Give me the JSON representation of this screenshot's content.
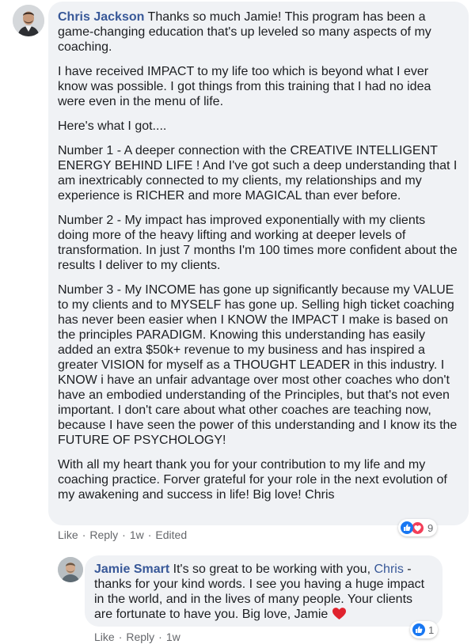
{
  "comment": {
    "author": "Chris Jackson",
    "first_line": "Thanks so much Jamie! This program has been a game-changing education that's up leveled so many aspects of my coaching.",
    "paragraphs": [
      "I have received IMPACT to my life too which is beyond what I ever know was possible. I got things from this training that I had no idea were even in the menu of life.",
      "Here's what I got....",
      "Number 1 - A deeper connection with the CREATIVE INTELLIGENT ENERGY BEHIND LIFE ! And I've got such a deep understanding that I am inextricably connected to my clients, my relationships and my experience is RICHER and more MAGICAL than ever before.",
      "Number 2 - My impact has improved exponentially with my clients doing more of the heavy lifting and working at deeper levels of transformation. In just 7 months I'm 100 times more confident about the results I deliver to my clients.",
      "Number 3 - My INCOME has gone up significantly because my VALUE to my clients and to MYSELF has gone up. Selling high ticket coaching has never been easier when I KNOW the IMPACT I make is based on the principles PARADIGM. Knowing this understanding has easily added an extra $50k+ revenue to my business and has inspired a greater VISION for myself as a THOUGHT LEADER in this industry. I KNOW i have an unfair advantage over most other coaches who don't have an embodied understanding of the Principles, but that's not even important. I don't care about what other coaches are teaching now, because I have seen the power of this understanding and I know its the FUTURE OF PSYCHOLOGY!",
      "With all my heart thank you for your contribution to my life and my coaching practice. Forver grateful for your role in the next evolution of my awakening and success in life! Big love! Chris"
    ],
    "actions": {
      "like": "Like",
      "reply": "Reply",
      "time": "1w",
      "edited": "Edited",
      "sep": "·"
    },
    "reaction_count": "9"
  },
  "reply": {
    "author": "Jamie Smart",
    "text_before_mention": "It's so great to be working with you,",
    "mention": "Chris",
    "text_after_mention": "- thanks for your kind words. I see you having a huge impact in the world, and in the lives of many people. Your clients are fortunate to have you. Big love, Jamie",
    "actions": {
      "like": "Like",
      "reply": "Reply",
      "time": "1w",
      "sep": "·"
    },
    "reaction_count": "1"
  },
  "colors": {
    "like_blue": "#1877f2",
    "love_red": "#f33e58",
    "name_blue": "#385898"
  },
  "icons": {
    "like": "thumbs-up-icon",
    "love": "heart-icon",
    "emoji": "red-heart-icon"
  }
}
